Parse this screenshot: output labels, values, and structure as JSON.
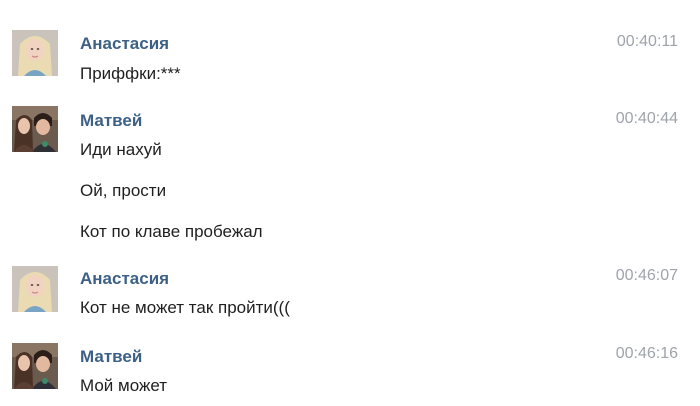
{
  "messages": [
    {
      "author": "Анастасия",
      "time": "00:40:11",
      "avatar": "blonde-girl-avatar",
      "lines": [
        "Приффки:***"
      ]
    },
    {
      "author": "Матвей",
      "time": "00:40:44",
      "avatar": "couple-photo-avatar",
      "lines": [
        "Иди нахуй",
        "Ой, прости",
        "Кот по клаве пробежал"
      ]
    },
    {
      "author": "Анастасия",
      "time": "00:46:07",
      "avatar": "blonde-girl-avatar",
      "lines": [
        "Кот не может так пройти((("
      ]
    },
    {
      "author": "Матвей",
      "time": "00:46:16",
      "avatar": "couple-photo-avatar",
      "lines": [
        "Мой может"
      ]
    }
  ],
  "colors": {
    "author": "#3d6186",
    "time": "#9ea4ab",
    "text": "#1f1f1f",
    "background": "#ffffff"
  }
}
